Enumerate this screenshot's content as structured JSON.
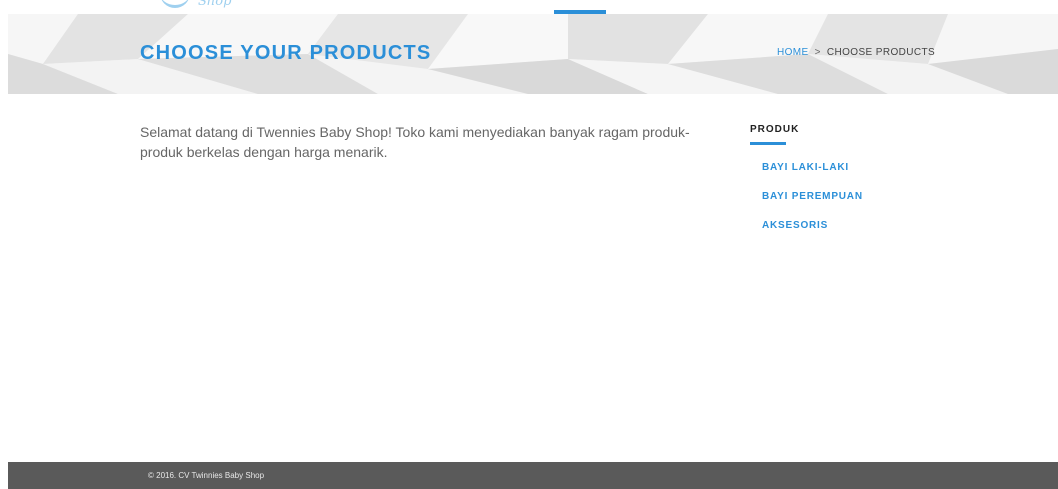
{
  "header": {
    "logo_text": "Shop"
  },
  "banner": {
    "title": "CHOOSE YOUR PRODUCTS",
    "breadcrumb": {
      "home": "HOME",
      "separator": ">",
      "current": "CHOOSE PRODUCTS"
    }
  },
  "main": {
    "intro_text": "Selamat datang di Twennies Baby Shop! Toko kami menyediakan banyak ragam produk-produk berkelas dengan harga menarik."
  },
  "sidebar": {
    "title": "PRODUK",
    "items": [
      {
        "label": "BAYI LAKI-LAKI"
      },
      {
        "label": "BAYI PEREMPUAN"
      },
      {
        "label": "AKSESORIS"
      }
    ]
  },
  "footer": {
    "copyright": "© 2016. CV Twinnies Baby Shop"
  },
  "colors": {
    "accent": "#2b8fd8",
    "banner_bg": "#ececec",
    "footer_bg": "#5a5a5a"
  }
}
